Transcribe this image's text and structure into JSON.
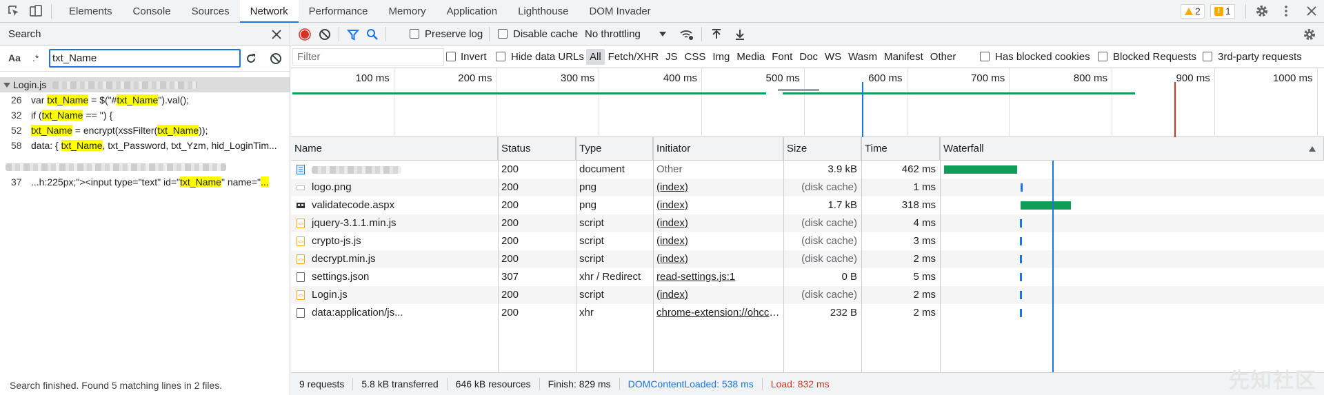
{
  "topbar": {
    "tabs": [
      "Elements",
      "Console",
      "Sources",
      "Network",
      "Performance",
      "Memory",
      "Application",
      "Lighthouse",
      "DOM Invader"
    ],
    "active_tab": "Network",
    "warnings_count": "2",
    "issues_count": "1",
    "icons": [
      "inspect-element-icon",
      "device-toolbar-icon",
      "gear-icon",
      "more-vert-icon",
      "close-icon"
    ]
  },
  "search": {
    "title": "Search",
    "case_toggle": "Aa",
    "regex_toggle": ".*",
    "query": "txt_Name",
    "results": [
      {
        "file": "Login.js",
        "matches": [
          {
            "line": "26",
            "parts": [
              "var ",
              "txt_Name",
              " = $(\"#",
              "txt_Name",
              "\").val();"
            ]
          },
          {
            "line": "32",
            "parts": [
              "if (",
              "txt_Name",
              " == '') {"
            ]
          },
          {
            "line": "52",
            "parts": [
              "",
              "txt_Name",
              " = encrypt(xssFilter(",
              "txt_Name",
              "));"
            ]
          },
          {
            "line": "58",
            "parts": [
              "data: { ",
              "txt_Name",
              ", txt_Password, txt_Yzm, hid_LoginTim..."
            ]
          }
        ]
      },
      {
        "file": "",
        "matches": [
          {
            "line": "37",
            "parts": [
              "...h:225px;\"><input type=\"text\" id=\"",
              "txt_Name",
              "\" name=\"",
              "...",
              ""
            ]
          }
        ]
      }
    ],
    "status": "Search finished.  Found 5 matching lines in 2 files."
  },
  "network": {
    "toolbar": {
      "preserve_log": "Preserve log",
      "disable_cache": "Disable cache",
      "throttling": "No throttling"
    },
    "filter": {
      "placeholder": "Filter",
      "invert": "Invert",
      "hide_data_urls": "Hide data URLs",
      "types": [
        "All",
        "Fetch/XHR",
        "JS",
        "CSS",
        "Img",
        "Media",
        "Font",
        "Doc",
        "WS",
        "Wasm",
        "Manifest",
        "Other"
      ],
      "has_blocked_cookies": "Has blocked cookies",
      "blocked_requests": "Blocked Requests",
      "third_party": "3rd-party requests"
    },
    "overview_ticks": [
      "100 ms",
      "200 ms",
      "300 ms",
      "400 ms",
      "500 ms",
      "600 ms",
      "700 ms",
      "800 ms",
      "900 ms",
      "1000 ms"
    ],
    "columns": [
      "Name",
      "Status",
      "Type",
      "Initiator",
      "Size",
      "Time",
      "Waterfall"
    ],
    "rows": [
      {
        "name": "",
        "status": "200",
        "type": "document",
        "initiator": "Other",
        "initiator_link": false,
        "size": "3.9 kB",
        "size_dim": false,
        "time": "462 ms",
        "icon": "document-icon",
        "waterfall_start": 0,
        "waterfall_ms": 462
      },
      {
        "name": "logo.png",
        "status": "200",
        "type": "png",
        "initiator": "(index)",
        "initiator_link": true,
        "size": "(disk cache)",
        "size_dim": true,
        "time": "1 ms",
        "icon": "image-icon",
        "waterfall_start": 470,
        "waterfall_ms": 1
      },
      {
        "name": "validatecode.aspx",
        "status": "200",
        "type": "png",
        "initiator": "(index)",
        "initiator_link": true,
        "size": "1.7 kB",
        "size_dim": false,
        "time": "318 ms",
        "icon": "image-thumb-icon",
        "waterfall_start": 470,
        "waterfall_ms": 318
      },
      {
        "name": "jquery-3.1.1.min.js",
        "status": "200",
        "type": "script",
        "initiator": "(index)",
        "initiator_link": true,
        "size": "(disk cache)",
        "size_dim": true,
        "time": "4 ms",
        "icon": "script-icon",
        "waterfall_start": 465,
        "waterfall_ms": 4
      },
      {
        "name": "crypto-js.js",
        "status": "200",
        "type": "script",
        "initiator": "(index)",
        "initiator_link": true,
        "size": "(disk cache)",
        "size_dim": true,
        "time": "3 ms",
        "icon": "script-icon",
        "waterfall_start": 465,
        "waterfall_ms": 3
      },
      {
        "name": "decrypt.min.js",
        "status": "200",
        "type": "script",
        "initiator": "(index)",
        "initiator_link": true,
        "size": "(disk cache)",
        "size_dim": true,
        "time": "2 ms",
        "icon": "script-icon",
        "waterfall_start": 465,
        "waterfall_ms": 2
      },
      {
        "name": "settings.json",
        "status": "307",
        "type": "xhr / Redirect",
        "initiator": "read-settings.js:1",
        "initiator_link": true,
        "size": "0 B",
        "size_dim": false,
        "time": "5 ms",
        "icon": "blank-file-icon",
        "waterfall_start": 466,
        "waterfall_ms": 5
      },
      {
        "name": "Login.js",
        "status": "200",
        "type": "script",
        "initiator": "(index)",
        "initiator_link": true,
        "size": "(disk cache)",
        "size_dim": true,
        "time": "2 ms",
        "icon": "script-icon",
        "waterfall_start": 465,
        "waterfall_ms": 2
      },
      {
        "name": "data:application/js...",
        "status": "200",
        "type": "xhr",
        "initiator": "chrome-extension://ohccdlocfl...",
        "initiator_link": true,
        "size": "232 B",
        "size_dim": false,
        "time": "2 ms",
        "icon": "blank-file-icon",
        "waterfall_start": 466,
        "waterfall_ms": 2
      }
    ],
    "status": {
      "requests": "9 requests",
      "transferred": "5.8 kB transferred",
      "resources": "646 kB resources",
      "finish": "Finish: 829 ms",
      "dcl": "DOMContentLoaded: 538 ms",
      "load": "Load: 832 ms"
    },
    "dcl_ms": 538,
    "load_ms": 832,
    "colors": {
      "accent": "#1a73e8",
      "record": "#d93025",
      "bar": "#0f9d58",
      "dcl": "#1a73e8",
      "load": "#d93025"
    }
  }
}
